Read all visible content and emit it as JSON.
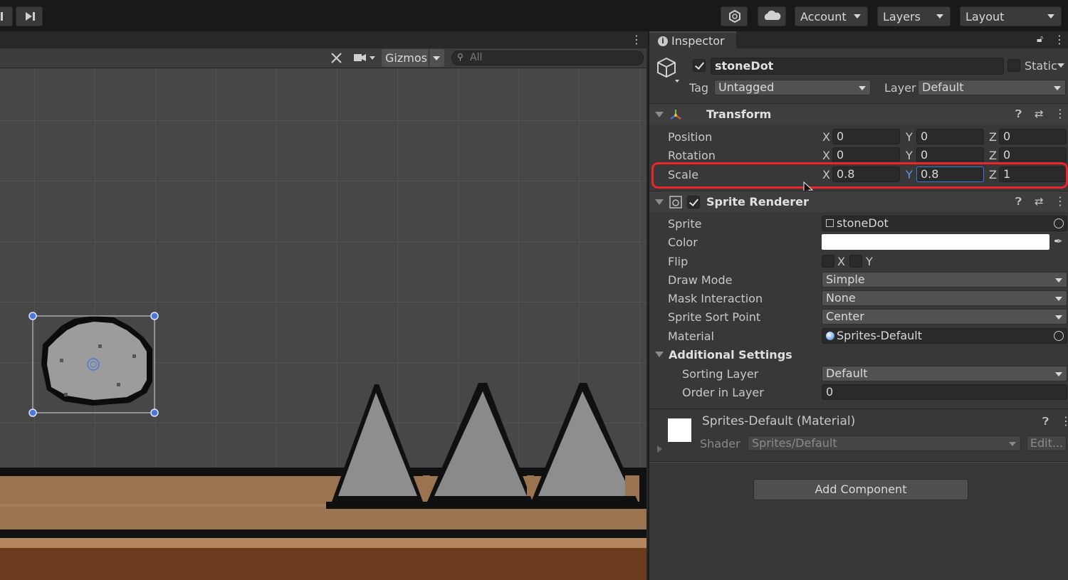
{
  "toolbar": {
    "account": "Account",
    "layers": "Layers",
    "layout": "Layout"
  },
  "scene": {
    "gizmos": "Gizmos",
    "search_placeholder": "All"
  },
  "inspector": {
    "tab": "Inspector",
    "object_name": "stoneDot",
    "static_label": "Static",
    "tag_label": "Tag",
    "tag_value": "Untagged",
    "layer_label": "Layer",
    "layer_value": "Default",
    "transform": {
      "title": "Transform",
      "position_label": "Position",
      "rotation_label": "Rotation",
      "scale_label": "Scale",
      "axis_x": "X",
      "axis_y": "Y",
      "axis_z": "Z",
      "position": {
        "x": "0",
        "y": "0",
        "z": "0"
      },
      "rotation": {
        "x": "0",
        "y": "0",
        "z": "0"
      },
      "scale": {
        "x": "0.8",
        "y": "0.8",
        "z": "1"
      }
    },
    "sprite_renderer": {
      "title": "Sprite Renderer",
      "sprite_label": "Sprite",
      "sprite_value": "stoneDot",
      "color_label": "Color",
      "color_value": "#ffffff",
      "flip_label": "Flip",
      "flip_x": "X",
      "flip_y": "Y",
      "draw_mode_label": "Draw Mode",
      "draw_mode_value": "Simple",
      "mask_label": "Mask Interaction",
      "mask_value": "None",
      "sort_point_label": "Sprite Sort Point",
      "sort_point_value": "Center",
      "material_label": "Material",
      "material_value": "Sprites-Default",
      "additional_settings": "Additional Settings",
      "sorting_layer_label": "Sorting Layer",
      "sorting_layer_value": "Default",
      "order_label": "Order in Layer",
      "order_value": "0"
    },
    "material": {
      "title": "Sprites-Default (Material)",
      "shader_label": "Shader",
      "shader_value": "Sprites/Default",
      "edit_label": "Edit..."
    },
    "add_component": "Add Component"
  },
  "colors": {
    "highlight": "#e8262c",
    "active_field_border": "#3a79d7"
  }
}
